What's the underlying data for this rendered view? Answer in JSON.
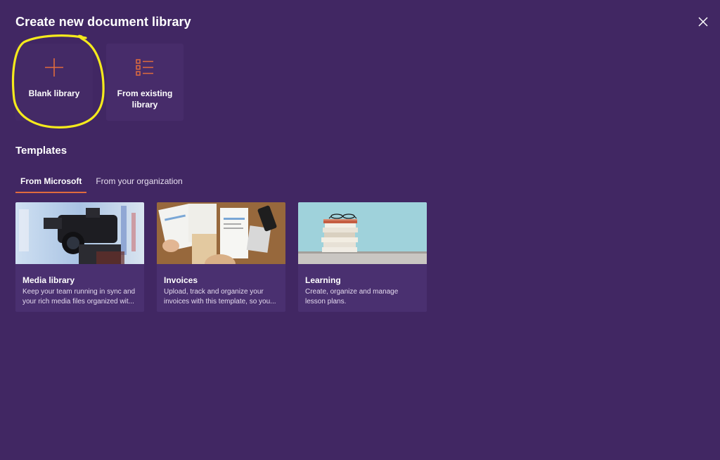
{
  "dialog": {
    "title": "Create new document library",
    "close_icon": "close-icon"
  },
  "create_options": [
    {
      "label": "Blank library",
      "icon": "plus-icon"
    },
    {
      "label": "From existing library",
      "icon": "list-icon"
    }
  ],
  "templates": {
    "heading": "Templates",
    "tabs": [
      {
        "label": "From Microsoft",
        "active": true
      },
      {
        "label": "From your organization",
        "active": false
      }
    ],
    "cards": [
      {
        "title": "Media library",
        "description": "Keep your team running in sync and your rich media files organized wit...",
        "image": "video-camera-photo"
      },
      {
        "title": "Invoices",
        "description": "Upload, track and organize your invoices with this template, so you...",
        "image": "invoice-papers-photo"
      },
      {
        "title": "Learning",
        "description": "Create, organize and manage lesson plans.",
        "image": "stacked-books-photo"
      }
    ]
  },
  "colors": {
    "background": "#412763",
    "accent": "#e06b3d",
    "highlight": "#f5ea1c"
  }
}
